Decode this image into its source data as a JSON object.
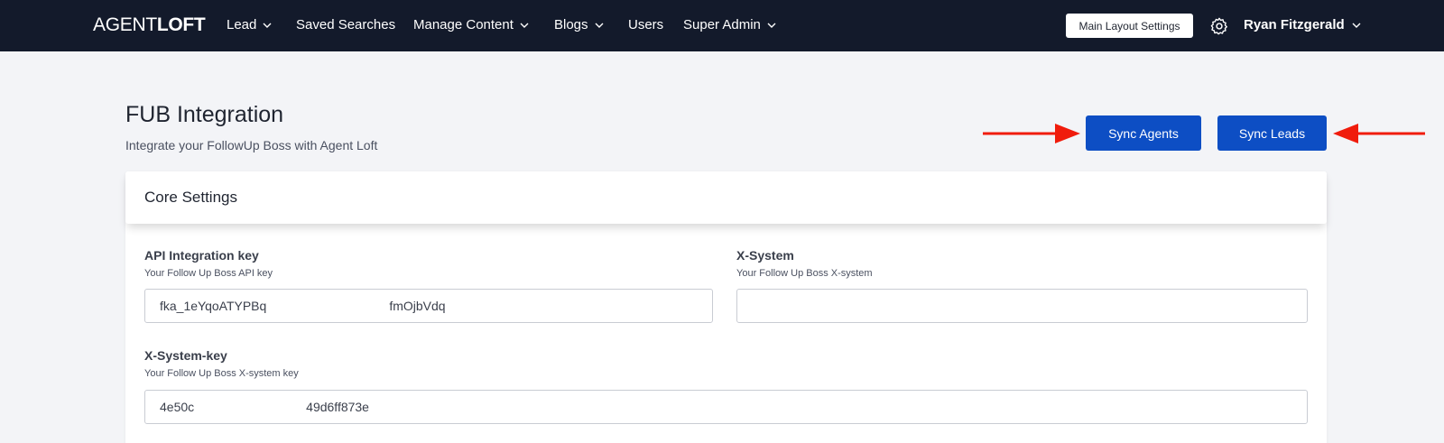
{
  "navbar": {
    "logo_light": "AGENT",
    "logo_bold": "LOFT",
    "items": [
      {
        "label": "Lead"
      },
      {
        "label": "Saved Searches"
      },
      {
        "label": "Manage Content"
      },
      {
        "label": "Blogs"
      },
      {
        "label": "Users"
      },
      {
        "label": "Super Admin"
      }
    ],
    "layout_button": "Main Layout Settings",
    "user_name": "Ryan Fitzgerald",
    "icons": {
      "settings": "gear-icon",
      "dropdown": "chevron-down-icon"
    }
  },
  "header": {
    "title": "FUB Integration",
    "subtitle": "Integrate your FollowUp Boss with Agent Loft",
    "sync_agents": "Sync Agents",
    "sync_leads": "Sync Leads"
  },
  "colors": {
    "navbar": "#131a2b",
    "primary": "#0d4ec4",
    "annotation_arrow": "#f01c0c"
  },
  "card": {
    "title": "Core Settings",
    "fields": {
      "api_key": {
        "label": "API Integration key",
        "help": "Your Follow Up Boss API key",
        "value_start": "fka_1eYqoATYPBq",
        "value_end": "fmOjbVdq"
      },
      "x_system": {
        "label": "X-System",
        "help": "Your Follow Up Boss X-system",
        "value": ""
      },
      "x_system_key": {
        "label": "X-System-key",
        "help": "Your Follow Up Boss X-system key",
        "value_start": "4e50c",
        "value_end": "49d6ff873e"
      }
    }
  }
}
